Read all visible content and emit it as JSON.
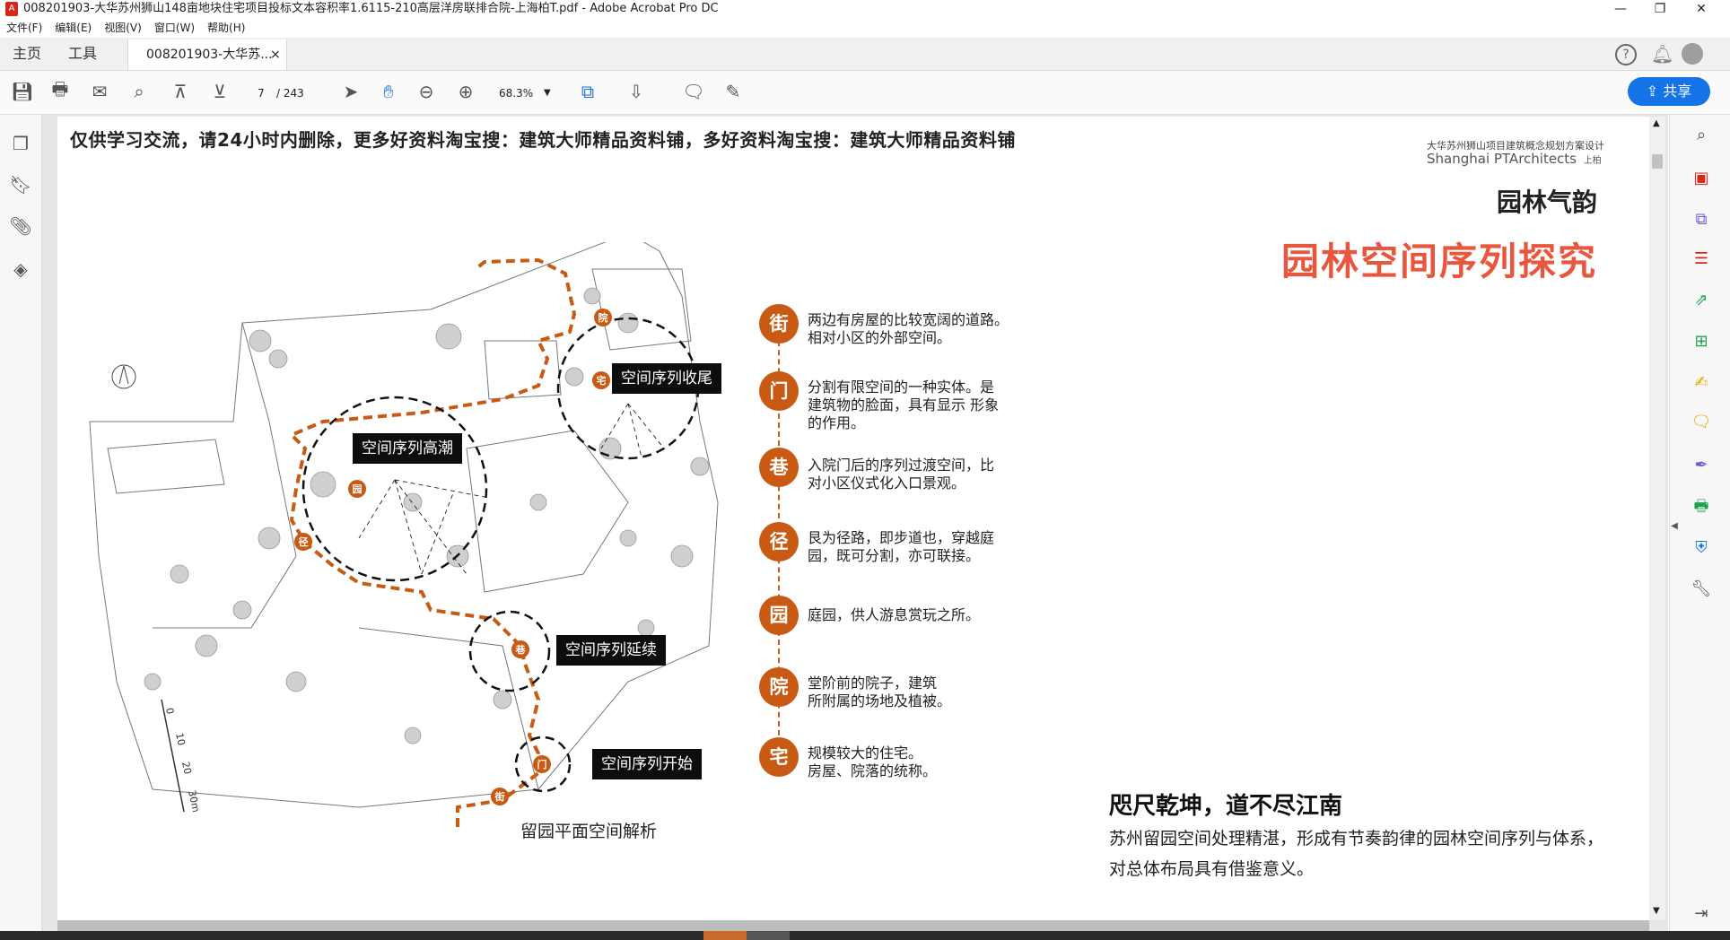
{
  "window": {
    "title": "008201903-大华苏州狮山148亩地块住宅项目投标文本容积率1.6115-210高层洋房联排合院-上海柏T.pdf - Adobe Acrobat Pro DC",
    "controls": [
      "—",
      "❐",
      "✕"
    ]
  },
  "menu": [
    "文件(F)",
    "编辑(E)",
    "视图(V)",
    "窗口(W)",
    "帮助(H)"
  ],
  "tabs": {
    "home": "主页",
    "tools": "工具",
    "document": "008201903-大华苏...",
    "close": "×"
  },
  "toolbar": {
    "page_current": "7",
    "page_total": "/ 243",
    "zoom": "68.3%",
    "share": "共享"
  },
  "page": {
    "disclaimer": "仅供学习交流，请24小时内删除，更多好资料淘宝搜：建筑大师精品资料铺，多好资料淘宝搜：建筑大师精品资料铺",
    "logo_line1": "大华苏州狮山项目建筑概念规划方案设计",
    "logo_line2": "Shanghai PTArchitects",
    "logo_mark": "上柏",
    "section_title": "园林气韵",
    "main_title": "园林空间序列探究",
    "plan_caption": "留园平面空间解析",
    "callouts": {
      "end": "空间序列收尾",
      "climax": "空间序列高潮",
      "continue": "空间序列延续",
      "start": "空间序列开始"
    },
    "sequence": [
      {
        "char": "街",
        "lines": [
          "两边有房屋的比较宽阔的道路。",
          "相对小区的外部空间。"
        ]
      },
      {
        "char": "门",
        "lines": [
          "分割有限空间的一种实体。是",
          "建筑物的脸面，具有显示 形象",
          "的作用。"
        ]
      },
      {
        "char": "巷",
        "lines": [
          "入院门后的序列过渡空间，比",
          "对小区仪式化入口景观。"
        ]
      },
      {
        "char": "径",
        "lines": [
          "艮为径路，即步道也，穿越庭",
          "园，既可分割，亦可联接。"
        ]
      },
      {
        "char": "园",
        "lines": [
          "庭园，供人游息赏玩之所。"
        ]
      },
      {
        "char": "院",
        "lines": [
          "堂阶前的院子，建筑",
          "所附属的场地及植被。"
        ]
      },
      {
        "char": "宅",
        "lines": [
          "规模较大的住宅。",
          "房屋、院落的统称。"
        ]
      }
    ],
    "path_marks": [
      "院",
      "宅",
      "园",
      "径",
      "巷",
      "门",
      "街"
    ],
    "scale_labels": [
      "0",
      "10",
      "20",
      "30m"
    ],
    "slogan_title": "咫尺乾坤，道不尽江南",
    "slogan_line1": "苏州留园空间处理精湛，形成有节奏韵律的园林空间序列与体系，",
    "slogan_line2": "对总体布局具有借鉴意义。"
  },
  "colors": {
    "accent": "#c85a14",
    "title_red": "#e8573d",
    "acrobat_blue": "#1473e6"
  }
}
